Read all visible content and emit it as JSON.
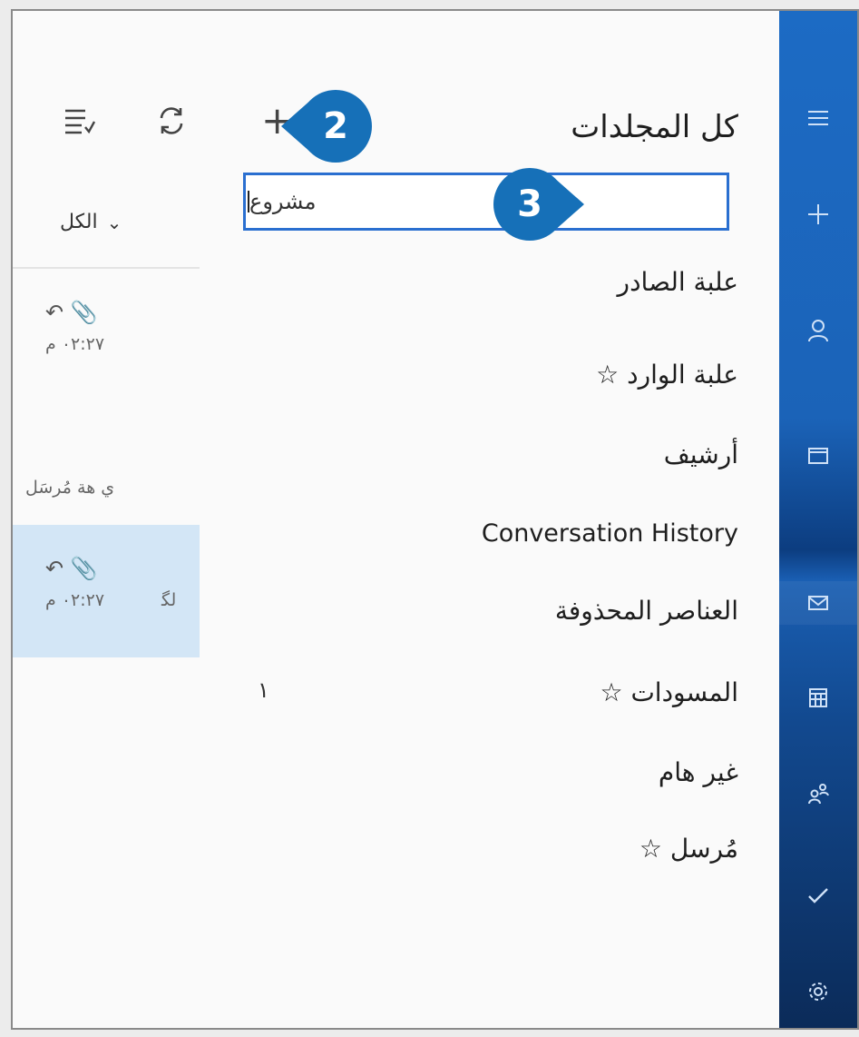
{
  "folders": {
    "title": "كل المجلدات",
    "new_folder_value": "مشروع",
    "items": [
      {
        "label": "علبة الصادر"
      },
      {
        "label": "علبة الوارد ☆"
      },
      {
        "label": "أرشيف"
      },
      {
        "label": "Conversation History"
      },
      {
        "label": "العناصر المحذوفة"
      },
      {
        "label": "المسودات ☆",
        "count": "١"
      },
      {
        "label": "غير هام"
      },
      {
        "label": "مُرسل ☆"
      }
    ]
  },
  "toolbar": {
    "add_glyph": "+",
    "sync_glyph": "⟳",
    "select_glyph": "≡"
  },
  "message_list": {
    "filter_label": "الكل",
    "filter_chevron": "⌄",
    "messages": [
      {
        "icons": "↶ 📎",
        "time": "٠٢:٢٧ م"
      },
      {
        "sender": "ي هة  مُرسَل"
      },
      {
        "icons": "↶ 📎",
        "time": "٠٢:٢٧ م",
        "sender_partial": "ﻟﮕ"
      }
    ]
  },
  "callouts": {
    "step_add": "2",
    "step_name": "3"
  },
  "colors": {
    "rail_blue": "#1c6bc4",
    "callout_blue": "#1670b8",
    "input_border": "#2a6fd0",
    "selected_row": "#d3e6f6"
  },
  "rail_icons": [
    "hamburger-icon",
    "plus-icon",
    "person-icon",
    "calendar-window-icon",
    "mail-icon",
    "calendar-icon",
    "people-icon",
    "check-icon",
    "gear-icon"
  ]
}
